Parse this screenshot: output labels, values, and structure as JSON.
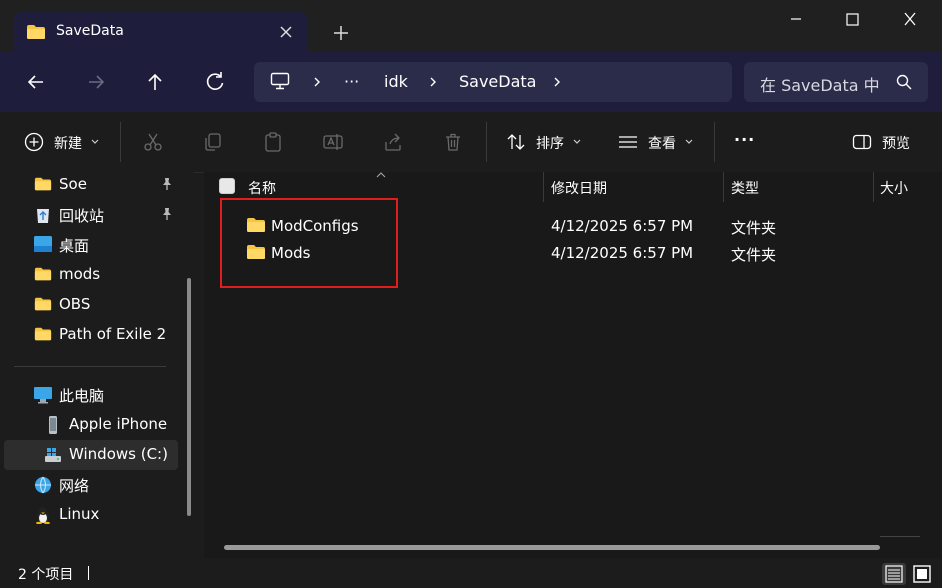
{
  "window": {
    "tab_title": "SaveData",
    "colors": {
      "titlebar": "#202020",
      "tab": "#1e1e3c",
      "accent_highlight": "#e01e1e",
      "folder": "#f4c542"
    }
  },
  "address": {
    "crumbs": [
      "idk",
      "SaveData"
    ],
    "ellipsis": "···",
    "search_placeholder": "在 SaveData 中搜索"
  },
  "toolbar": {
    "new_label": "新建",
    "sort_label": "排序",
    "view_label": "查看",
    "more_label": "···",
    "preview_label": "预览",
    "icons": [
      "cut-icon",
      "copy-icon",
      "paste-icon",
      "rename-icon",
      "share-icon",
      "delete-icon"
    ]
  },
  "sidebar": {
    "quick_access": [
      {
        "label": "Soe",
        "icon": "folder-icon",
        "pinned": true
      },
      {
        "label": "回收站",
        "icon": "recycle-bin-icon",
        "pinned": true
      },
      {
        "label": "桌面",
        "icon": "desktop-icon",
        "pinned": false
      },
      {
        "label": "mods",
        "icon": "folder-icon",
        "pinned": false
      },
      {
        "label": "OBS",
        "icon": "folder-icon",
        "pinned": false
      },
      {
        "label": "Path of Exile 2",
        "icon": "folder-icon",
        "pinned": false
      }
    ],
    "this_pc": {
      "label": "此电脑",
      "icon": "computer-icon"
    },
    "devices": [
      {
        "label": "Apple iPhone",
        "icon": "phone-icon"
      },
      {
        "label": "Windows (C:)",
        "icon": "drive-icon",
        "selected": true
      }
    ],
    "network": {
      "label": "网络",
      "icon": "network-icon"
    },
    "linux": {
      "label": "Linux",
      "icon": "linux-icon"
    }
  },
  "filelist": {
    "columns": {
      "name": "名称",
      "modified": "修改日期",
      "type": "类型",
      "size": "大小"
    },
    "rows": [
      {
        "name": "ModConfigs",
        "modified": "4/12/2025 6:57 PM",
        "type": "文件夹"
      },
      {
        "name": "Mods",
        "modified": "4/12/2025 6:57 PM",
        "type": "文件夹"
      }
    ]
  },
  "status": {
    "count": "2 个项目"
  }
}
